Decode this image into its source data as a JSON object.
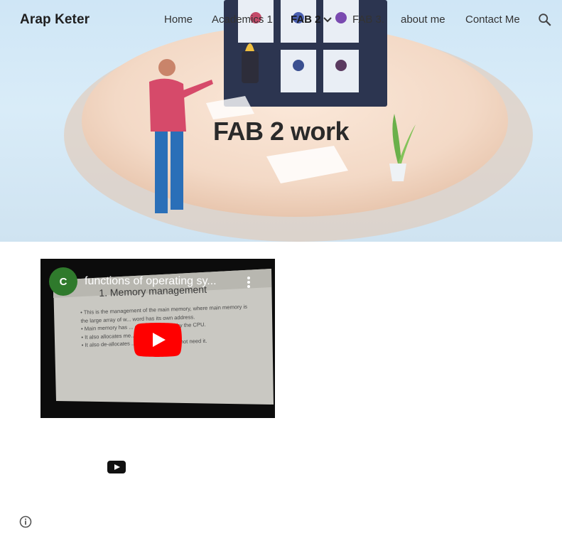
{
  "site": {
    "title": "Arap Keter"
  },
  "nav": {
    "items": [
      {
        "label": "Home",
        "active": false
      },
      {
        "label": "Academics 1",
        "active": false
      },
      {
        "label": "FAB 2",
        "active": true
      },
      {
        "label": "FAB 3.",
        "active": false
      },
      {
        "label": "about me",
        "active": false
      },
      {
        "label": "Contact Me",
        "active": false
      }
    ]
  },
  "hero": {
    "title": "FAB 2 work"
  },
  "video": {
    "channel_initial": "C",
    "title": "functions of operating sy...",
    "slide_heading": "1. Memory management",
    "slide_bullets": [
      "• This is the management of the main memory, where main memory is",
      "  the large array of w... word has its own address.",
      "• Main memory has ... can be accessed by the CPU.",
      "• It also allocates me... or needs it.",
      "• It also de-allocates ... e processor does not need it."
    ]
  },
  "icons": {
    "search": "search-icon",
    "chevron": "chevron-down-icon",
    "play": "play-icon",
    "youtube": "youtube-logo-icon",
    "info": "info-icon",
    "menu": "more-vert-icon"
  },
  "colors": {
    "text": "#1f1f1f",
    "youtube_red": "#ff0000",
    "avatar_green": "#2f7a2c"
  }
}
